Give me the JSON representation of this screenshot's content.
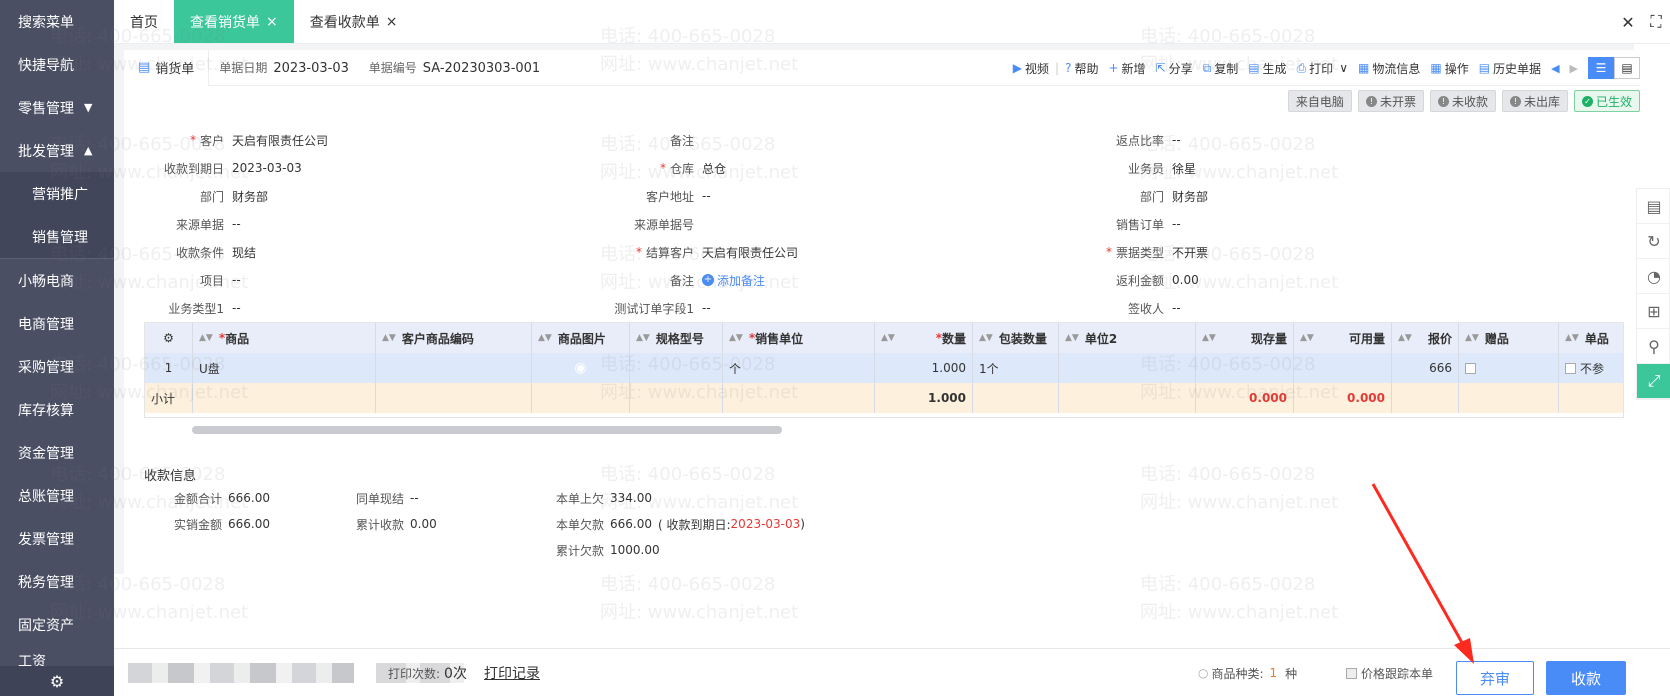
{
  "sidebar": {
    "items": [
      {
        "label": "搜索菜单"
      },
      {
        "label": "快捷导航"
      },
      {
        "label": "零售管理",
        "caret": "▼"
      },
      {
        "label": "批发管理",
        "caret": "▲"
      },
      {
        "label": "营销推广"
      },
      {
        "label": "销售管理"
      },
      {
        "label": "小畅电商"
      },
      {
        "label": "电商管理"
      },
      {
        "label": "采购管理"
      },
      {
        "label": "库存核算"
      },
      {
        "label": "资金管理"
      },
      {
        "label": "总账管理"
      },
      {
        "label": "发票管理"
      },
      {
        "label": "税务管理"
      },
      {
        "label": "固定资产"
      },
      {
        "label": "工资"
      }
    ],
    "gear_icon": "⚙"
  },
  "tabs": [
    {
      "label": "首页",
      "close": ""
    },
    {
      "label": "查看销货单",
      "close": "×"
    },
    {
      "label": "查看收款单",
      "close": "×"
    }
  ],
  "window_controls": {
    "close": "✕",
    "fullscreen": "⛶"
  },
  "doc": {
    "type_label": "销货单",
    "date_label": "单据日期",
    "date_value": "2023-03-03",
    "no_label": "单据编号",
    "no_value": "SA-20230303-001"
  },
  "toolbar": [
    {
      "icon": "▶",
      "label": "视频"
    },
    {
      "icon": "?",
      "label": "帮助"
    },
    {
      "icon": "+",
      "label": "新增"
    },
    {
      "icon": "⇱",
      "label": "分享"
    },
    {
      "icon": "⧉",
      "label": "复制"
    },
    {
      "icon": "▤",
      "label": "生成"
    },
    {
      "icon": "⎙",
      "label": "打印",
      "extra": "∨"
    },
    {
      "icon": "▦",
      "label": "物流信息"
    },
    {
      "icon": "▦",
      "label": "操作"
    },
    {
      "icon": "▤",
      "label": "历史单据"
    }
  ],
  "nav": {
    "prev": "◀",
    "next": "▶"
  },
  "status": [
    {
      "label": "来自电脑",
      "icon": ""
    },
    {
      "label": "未开票",
      "icon": "!"
    },
    {
      "label": "未收款",
      "icon": "!"
    },
    {
      "label": "未出库",
      "icon": "!"
    },
    {
      "label": "已生效",
      "icon": "✓"
    }
  ],
  "form": {
    "customer_label": "客户",
    "customer": "天启有限责任公司",
    "remark_label": "备注",
    "rebate_ratio_label": "返点比率",
    "rebate_ratio": "--",
    "due_date_label": "收款到期日",
    "due_date": "2023-03-03",
    "warehouse_label": "仓库",
    "warehouse": "总仓",
    "salesman_label": "业务员",
    "salesman": "徐星",
    "dept_label": "部门",
    "dept": "财务部",
    "cust_addr_label": "客户地址",
    "cust_addr": "--",
    "dept2_label": "部门",
    "dept2": "财务部",
    "source_label": "来源单据",
    "source": "--",
    "source_no_label": "来源单据号",
    "sales_order_label": "销售订单",
    "sales_order": "--",
    "terms_label": "收款条件",
    "terms": "现结",
    "settle_label": "结算客户",
    "settle": "天启有限责任公司",
    "invoice_type_label": "票据类型",
    "invoice_type": "不开票",
    "project_label": "项目",
    "project": "--",
    "remark2_label": "备注",
    "add_note": "添加备注",
    "rebate_amt_label": "返利金额",
    "rebate_amt": "0.00",
    "biz_type_label": "业务类型1",
    "biz_type": "--",
    "test_field_label": "测试订单字段1",
    "test_field": "--",
    "signer_label": "签收人",
    "signer": "--"
  },
  "grid": {
    "gear": "⚙",
    "headers": [
      "商品",
      "客户商品编码",
      "商品图片",
      "规格型号",
      "销售单位",
      "数量",
      "包装数量",
      "单位2",
      "现存量",
      "可用量",
      "报价",
      "赠品",
      "单品"
    ],
    "row": {
      "idx": "1",
      "product": "U盘",
      "unit": "个",
      "qty": "1.000",
      "pack": "1个",
      "price": "666",
      "tail": "不参"
    },
    "subtotal": {
      "label": "小计",
      "qty": "1.000",
      "stock": "0.000",
      "avail": "0.000"
    }
  },
  "receipt": {
    "title": "收款信息",
    "total_label": "金额合计",
    "total": "666.00",
    "actual_label": "实销金额",
    "actual": "666.00",
    "same_cash_label": "同单现结",
    "same_cash": "--",
    "cum_label": "累计收款",
    "cum": "0.00",
    "prev_owe_label": "本单上欠",
    "prev_owe": "334.00",
    "owe_label": "本单欠款",
    "owe": "666.00",
    "owe_note_pre": "( 收款到期日: ",
    "owe_note_date": "2023-03-03",
    "owe_note_post": " )",
    "cum_owe_label": "累计欠款",
    "cum_owe": "1000.00"
  },
  "footer": {
    "print_count_label": "打印次数:",
    "print_count": "0次",
    "print_log": "打印记录",
    "kind_label": "商品种类:",
    "kind_count": "1",
    "kind_unit": "种",
    "track_label": "价格跟踪本单",
    "abandon": "弃审",
    "collect": "收款"
  },
  "watermark": {
    "phone": "电话: 400-665-0028",
    "site": "网址: www.chanjet.net"
  }
}
